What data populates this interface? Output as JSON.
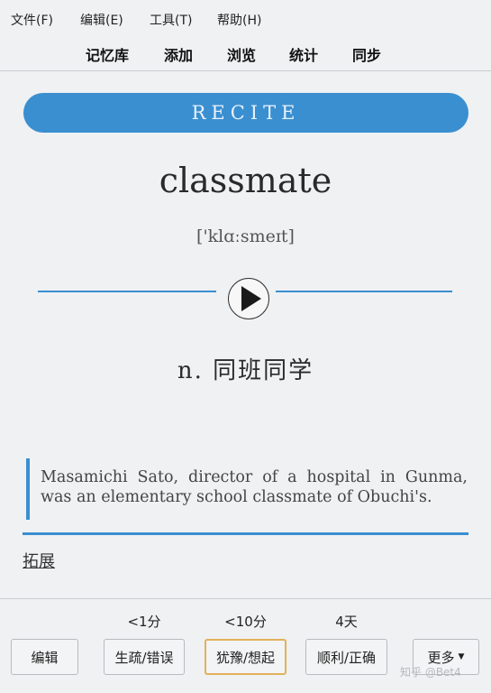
{
  "menu": [
    "文件(F)",
    "编辑(E)",
    "工具(T)",
    "帮助(H)"
  ],
  "nav": [
    "记忆库",
    "添加",
    "浏览",
    "统计",
    "同步"
  ],
  "card": {
    "mode": "RECITE",
    "word": "classmate",
    "phonetic": "['klɑːsmeɪt]",
    "meaning": "n. 同班同学",
    "example": "Masamichi Sato, director of a hospital in Gunma, was an elementary school classmate of Obuchi's.",
    "extend_label": "拓展"
  },
  "answer": {
    "intervals": [
      "<1分",
      "<10分",
      "4天"
    ],
    "edit_label": "编辑",
    "buttons": [
      "生疏/错误",
      "犹豫/想起",
      "顺利/正确"
    ],
    "more_label": "更多"
  },
  "watermark": "知乎 @Bet4",
  "colors": {
    "accent": "#3a8fd0",
    "highlight": "#e2b15a"
  }
}
